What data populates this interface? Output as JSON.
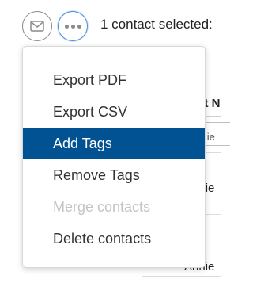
{
  "toolbar": {
    "mail_icon": "mail-icon",
    "more_icon": "more-horizontal-icon",
    "selected_text": "1 contact selected:"
  },
  "table": {
    "column_header": "First N",
    "filter_value": "annie",
    "rows": [
      {
        "first_name": "Annie"
      },
      {
        "first_name": "Annie"
      }
    ]
  },
  "menu": {
    "items": [
      {
        "label": "Export PDF",
        "state": "normal"
      },
      {
        "label": "Export CSV",
        "state": "normal"
      },
      {
        "label": "Add Tags",
        "state": "highlighted"
      },
      {
        "label": "Remove Tags",
        "state": "normal"
      },
      {
        "label": "Merge contacts",
        "state": "disabled"
      },
      {
        "label": "Delete contacts",
        "state": "normal"
      }
    ]
  },
  "colors": {
    "highlight": "#005293",
    "disabled_text": "#c4c4c4",
    "focus_ring": "#4a90d9"
  }
}
